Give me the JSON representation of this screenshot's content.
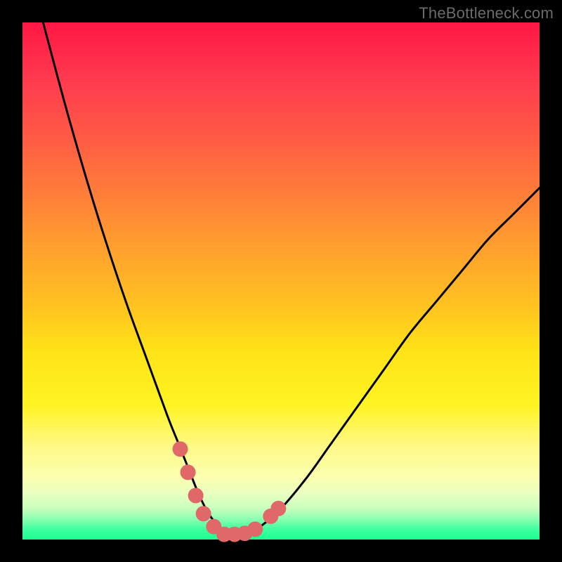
{
  "watermark": "TheBottleneck.com",
  "colors": {
    "page_bg": "#000000",
    "curve": "#000000",
    "marker": "#e06868",
    "watermark": "#6b6b6b"
  },
  "chart_data": {
    "type": "line",
    "title": "",
    "xlabel": "",
    "ylabel": "",
    "xlim": [
      0,
      100
    ],
    "ylim": [
      0,
      100
    ],
    "grid": false,
    "series": [
      {
        "name": "bottleneck_curve",
        "x": [
          4,
          8,
          12,
          16,
          20,
          24,
          28,
          30,
          32,
          34,
          36,
          38,
          40,
          42,
          44,
          46,
          50,
          55,
          60,
          65,
          70,
          75,
          80,
          85,
          90,
          95,
          100
        ],
        "y": [
          100,
          85,
          71,
          58,
          46,
          35,
          24,
          19,
          14,
          9,
          5,
          2.5,
          1,
          1,
          1.5,
          2.5,
          6,
          12,
          19,
          26,
          33,
          40,
          46,
          52,
          58,
          63,
          68
        ]
      }
    ],
    "markers": [
      {
        "x": 30.5,
        "y": 17.5
      },
      {
        "x": 32.0,
        "y": 13.0
      },
      {
        "x": 33.5,
        "y": 8.5
      },
      {
        "x": 35.0,
        "y": 5.0
      },
      {
        "x": 37.0,
        "y": 2.5
      },
      {
        "x": 39.0,
        "y": 1.0
      },
      {
        "x": 41.0,
        "y": 1.0
      },
      {
        "x": 43.0,
        "y": 1.2
      },
      {
        "x": 45.0,
        "y": 2.0
      },
      {
        "x": 48.0,
        "y": 4.5
      },
      {
        "x": 49.5,
        "y": 6.0
      }
    ]
  }
}
